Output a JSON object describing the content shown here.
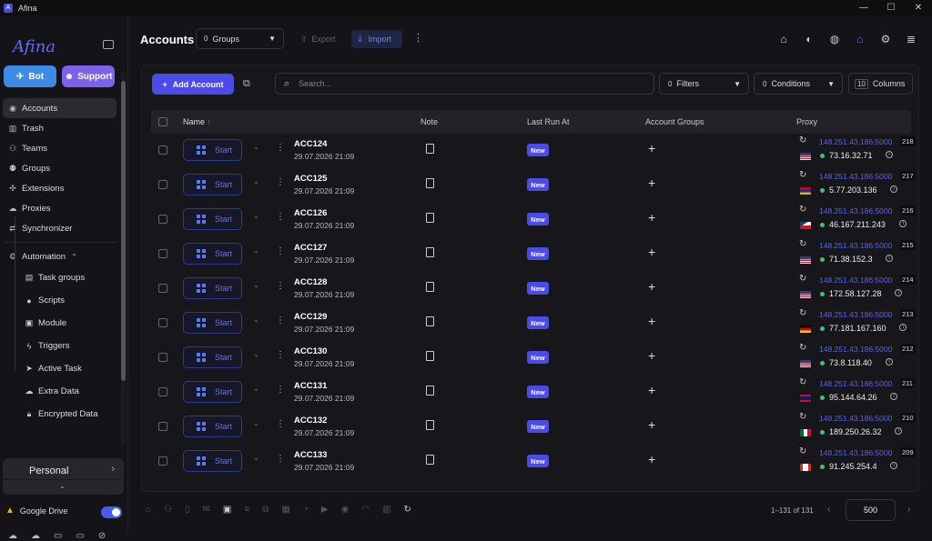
{
  "window": {
    "title": "Afina",
    "logo_letter": "A",
    "min": "—",
    "max": "☐",
    "close": "✕"
  },
  "sidebar": {
    "brand": "Afina",
    "bot_label": "Bot",
    "support_label": "Support",
    "items": [
      {
        "label": "Accounts",
        "icon": "person-circle-icon"
      },
      {
        "label": "Trash",
        "icon": "trash-icon"
      },
      {
        "label": "Teams",
        "icon": "team-icon"
      },
      {
        "label": "Groups",
        "icon": "groups-icon"
      },
      {
        "label": "Extensions",
        "icon": "puzzle-icon"
      },
      {
        "label": "Proxies",
        "icon": "cloud-icon"
      },
      {
        "label": "Synchronizer",
        "icon": "sync-icon"
      }
    ],
    "automation_label": "Automation",
    "sub_items": [
      {
        "label": "Task groups",
        "icon": "list-icon"
      },
      {
        "label": "Scripts",
        "icon": "github-icon"
      },
      {
        "label": "Module",
        "icon": "module-icon"
      },
      {
        "label": "Triggers",
        "icon": "bolt-icon"
      },
      {
        "label": "Active Task",
        "icon": "run-icon"
      },
      {
        "label": "Extra Data",
        "icon": "cloud-data-icon"
      },
      {
        "label": "Encrypted Data",
        "icon": "lock-icon"
      }
    ],
    "workspace": "Personal",
    "gdrive_label": "Google Drive",
    "gdrive_enabled": true
  },
  "header": {
    "title": "Accounts",
    "groups_count": "0",
    "groups_label": "Groups",
    "export_label": "Export",
    "import_label": "Import"
  },
  "toolbar": {
    "add_label": "Add Account",
    "search_placeholder": "Search...",
    "filters_count": "0",
    "filters_label": "Filters",
    "conditions_count": "0",
    "conditions_label": "Conditions",
    "columns_count": "10",
    "columns_label": "Columns"
  },
  "columns": {
    "name": "Name",
    "sort": "↑",
    "note": "Note",
    "last_run": "Last Run At",
    "groups": "Account Groups",
    "proxy": "Proxy"
  },
  "start_label": "Start",
  "new_label": "New",
  "rows": [
    {
      "name": "ACC124",
      "date": "29.07.2026 21:09",
      "proxy": "148.251.43.186:5000",
      "port_num": "218",
      "ip": "73.16.32.71",
      "flag": "us"
    },
    {
      "name": "ACC125",
      "date": "29.07.2026 21:09",
      "proxy": "148.251.43.186:5000",
      "port_num": "217",
      "ip": "5.77.203.136",
      "flag": "am"
    },
    {
      "name": "ACC126",
      "date": "29.07.2026 21:09",
      "proxy": "148.251.43.186:5000",
      "port_num": "216",
      "ip": "46.167.211.243",
      "flag": "cz"
    },
    {
      "name": "ACC127",
      "date": "29.07.2026 21:09",
      "proxy": "148.251.43.186:5000",
      "port_num": "215",
      "ip": "71.38.152.3",
      "flag": "us"
    },
    {
      "name": "ACC128",
      "date": "29.07.2026 21:09",
      "proxy": "148.251.43.186:5000",
      "port_num": "214",
      "ip": "172.58.127.28",
      "flag": "us"
    },
    {
      "name": "ACC129",
      "date": "29.07.2026 21:09",
      "proxy": "148.251.43.186:5000",
      "port_num": "213",
      "ip": "77.181.167.160",
      "flag": "de"
    },
    {
      "name": "ACC130",
      "date": "29.07.2026 21:09",
      "proxy": "148.251.43.186:5000",
      "port_num": "212",
      "ip": "73.8.118.40",
      "flag": "us"
    },
    {
      "name": "ACC131",
      "date": "29.07.2026 21:09",
      "proxy": "148.251.43.186:5000",
      "port_num": "211",
      "ip": "95.144.64.26",
      "flag": "gb"
    },
    {
      "name": "ACC132",
      "date": "29.07.2026 21:09",
      "proxy": "148.251.43.186:5000",
      "port_num": "210",
      "ip": "189.250.26.32",
      "flag": "mx"
    },
    {
      "name": "ACC133",
      "date": "29.07.2026 21:09",
      "proxy": "148.251.43.186:5000",
      "port_num": "209",
      "ip": "91.245.254.4",
      "flag": "ca"
    }
  ],
  "footer": {
    "range": "1–131 of 131",
    "page_size": "500"
  },
  "colors": {
    "accent": "#4b4be6",
    "proxy_link": "#5a64e0",
    "online": "#2ecc71"
  }
}
